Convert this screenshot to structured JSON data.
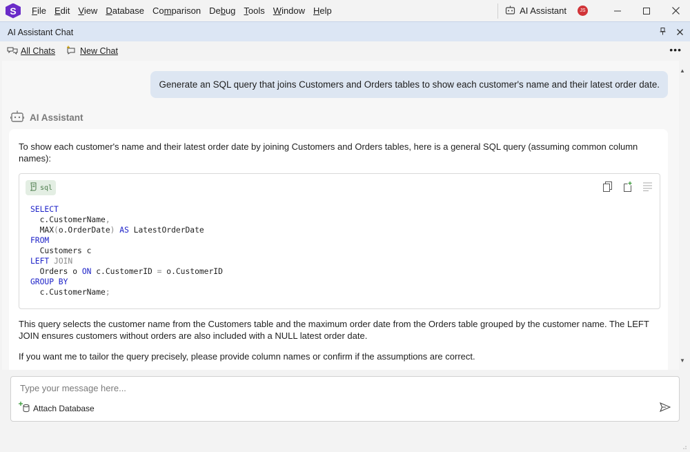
{
  "menubar": {
    "logo": "S",
    "items": [
      {
        "pre": "",
        "u": "F",
        "post": "ile"
      },
      {
        "pre": "",
        "u": "E",
        "post": "dit"
      },
      {
        "pre": "",
        "u": "V",
        "post": "iew"
      },
      {
        "pre": "",
        "u": "D",
        "post": "atabase"
      },
      {
        "pre": "Co",
        "u": "m",
        "post": "parison"
      },
      {
        "pre": "De",
        "u": "b",
        "post": "ug"
      },
      {
        "pre": "",
        "u": "T",
        "post": "ools"
      },
      {
        "pre": "",
        "u": "W",
        "post": "indow"
      },
      {
        "pre": "",
        "u": "H",
        "post": "elp"
      }
    ],
    "ai_assistant_label": "AI Assistant",
    "user_initials": "JS"
  },
  "panel": {
    "title": "AI Assistant Chat"
  },
  "toolbar": {
    "all_chats": "All Chats",
    "new_chat": "New Chat"
  },
  "chat": {
    "user_message": "Generate an SQL query that joins Customers and Orders tables to show each customer's name and their latest order date.",
    "assistant_name": "AI Assistant",
    "intro": "To show each customer's name and their latest order date by joining Customers and Orders tables, here is a general SQL query (assuming common column names):",
    "code_language": "sql",
    "code_lines": [
      {
        "parts": [
          {
            "t": "SELECT",
            "c": "kw"
          }
        ]
      },
      {
        "parts": [
          {
            "t": "  c.CustomerName",
            "c": ""
          },
          {
            "t": ",",
            "c": "gr"
          }
        ]
      },
      {
        "parts": [
          {
            "t": "  MAX",
            "c": ""
          },
          {
            "t": "(",
            "c": "gr"
          },
          {
            "t": "o.OrderDate",
            "c": ""
          },
          {
            "t": ")",
            "c": "gr"
          },
          {
            "t": " AS",
            "c": "kw"
          },
          {
            "t": " LatestOrderDate",
            "c": ""
          }
        ]
      },
      {
        "parts": [
          {
            "t": "FROM",
            "c": "kw"
          }
        ]
      },
      {
        "parts": [
          {
            "t": "  Customers c",
            "c": ""
          }
        ]
      },
      {
        "parts": [
          {
            "t": "LEFT",
            "c": "kw"
          },
          {
            "t": " JOIN",
            "c": "gr"
          }
        ]
      },
      {
        "parts": [
          {
            "t": "  Orders o ",
            "c": ""
          },
          {
            "t": "ON",
            "c": "kw"
          },
          {
            "t": " c.CustomerID ",
            "c": ""
          },
          {
            "t": "=",
            "c": "gr"
          },
          {
            "t": " o.CustomerID",
            "c": ""
          }
        ]
      },
      {
        "parts": [
          {
            "t": "GROUP BY",
            "c": "kw"
          }
        ]
      },
      {
        "parts": [
          {
            "t": "  c.CustomerName",
            "c": ""
          },
          {
            "t": ";",
            "c": "gr"
          }
        ]
      }
    ],
    "explanation": "This query selects the customer name from the Customers table and the maximum order date from the Orders table grouped by the customer name. The LEFT JOIN ensures customers without orders are also included with a NULL latest order date.",
    "followup": "If you want me to tailor the query precisely, please provide column names or confirm if the assumptions are correct."
  },
  "input": {
    "placeholder": "Type your message here...",
    "attach_label": "Attach Database"
  },
  "colors": {
    "accent": "#6a2bc8",
    "panel_header": "#dce6f4",
    "user_bubble": "#dde6f2",
    "keyword": "#1d22c8",
    "avatar": "#d13438"
  }
}
